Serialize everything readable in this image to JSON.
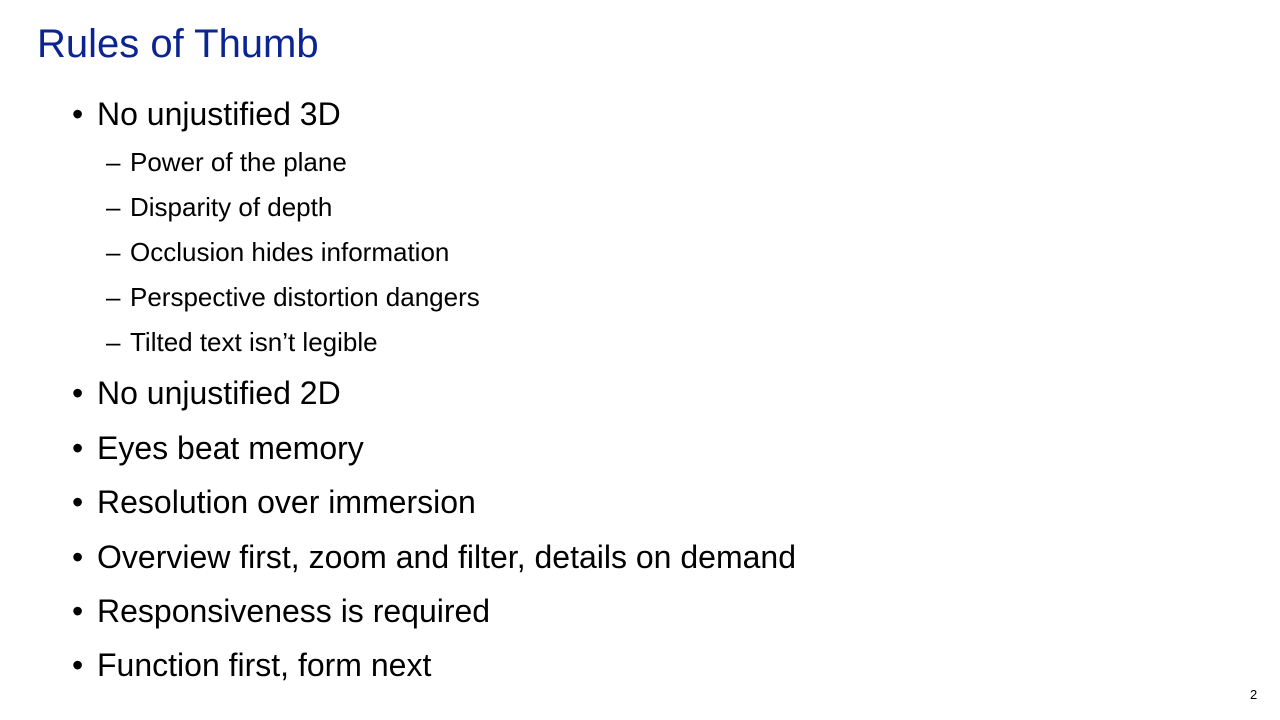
{
  "slide": {
    "title": "Rules of Thumb",
    "bullet_glyph": "•",
    "dash_glyph": "–",
    "items": [
      {
        "text": "No unjustified 3D",
        "subitems": [
          "Power of the plane",
          "Disparity of depth",
          "Occlusion hides information",
          "Perspective distortion dangers",
          "Tilted text isn’t legible"
        ]
      },
      {
        "text": "No unjustified 2D"
      },
      {
        "text": "Eyes beat memory"
      },
      {
        "text": "Resolution over immersion"
      },
      {
        "text": "Overview first, zoom and filter, details on demand"
      },
      {
        "text": "Responsiveness is required"
      },
      {
        "text": "Function first, form next"
      }
    ],
    "page_number": "2",
    "colors": {
      "title": "#0a2491",
      "text": "#000000",
      "background": "#ffffff"
    }
  }
}
